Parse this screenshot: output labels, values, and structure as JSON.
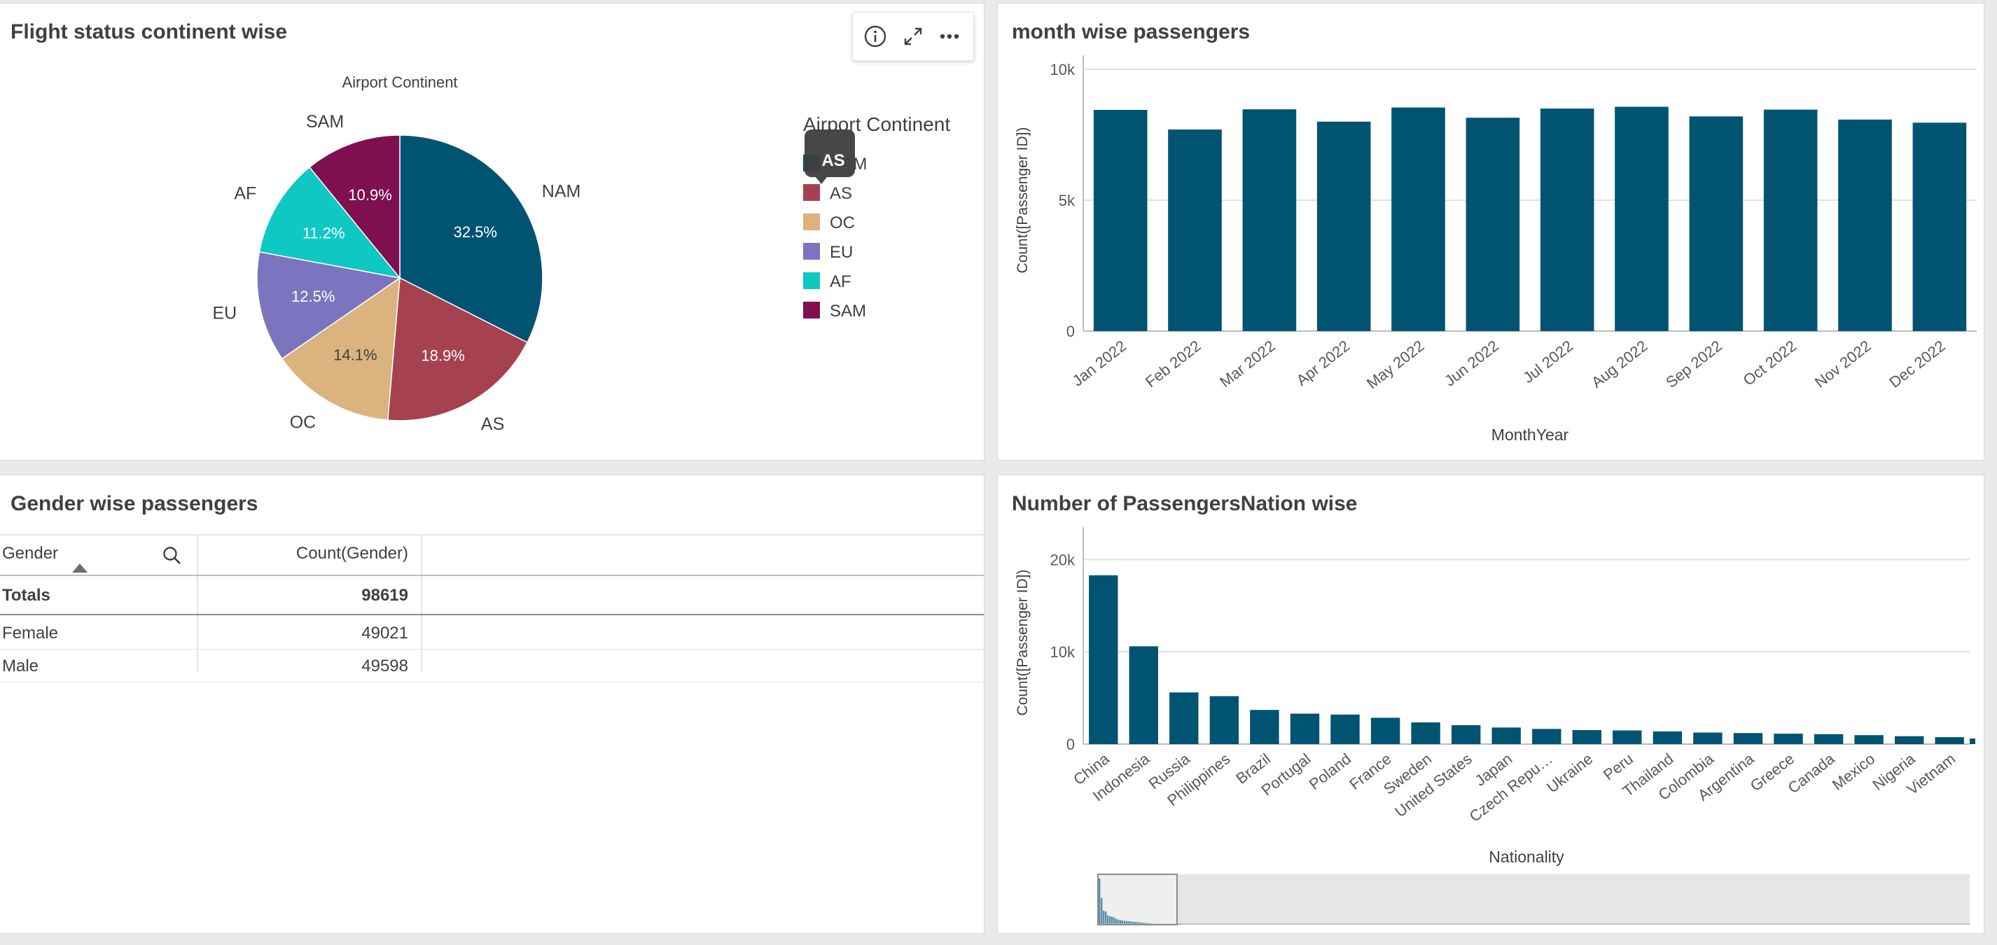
{
  "panels": {
    "pie": {
      "title": "Flight status continent wise"
    },
    "month": {
      "title": "month wise passengers"
    },
    "gender": {
      "title": "Gender wise passengers"
    },
    "nation": {
      "title": "Number of PassengersNation wise"
    }
  },
  "tooltip": {
    "text": "AS"
  },
  "table": {
    "headers": [
      "Gender",
      "Count(Gender)"
    ],
    "totals": {
      "label": "Totals",
      "value": "98619"
    },
    "rows": [
      {
        "gender": "Female",
        "count": "49021"
      },
      {
        "gender": "Male",
        "count": "49598"
      }
    ]
  },
  "colors": {
    "bar": "#005472",
    "NAM": "#005472",
    "AS": "#a6424f",
    "OC": "#dbb37e",
    "EU": "#7d74c0",
    "AF": "#0fc8c4",
    "SAM": "#7f0f4f"
  },
  "chart_data": [
    {
      "type": "pie",
      "title": "Airport Continent",
      "legend_title": "Airport Continent",
      "legend_position": "right",
      "slices": [
        {
          "label": "NAM",
          "value": 32.5,
          "text": "32.5%"
        },
        {
          "label": "AS",
          "value": 18.9,
          "text": "18.9%"
        },
        {
          "label": "OC",
          "value": 14.1,
          "text": "14.1%"
        },
        {
          "label": "EU",
          "value": 12.5,
          "text": "12.5%"
        },
        {
          "label": "AF",
          "value": 11.2,
          "text": "11.2%"
        },
        {
          "label": "SAM",
          "value": 10.9,
          "text": "10.9%"
        }
      ]
    },
    {
      "type": "bar",
      "categories": [
        "Jan 2022",
        "Feb 2022",
        "Mar 2022",
        "Apr 2022",
        "May 2022",
        "Jun 2022",
        "Jul 2022",
        "Aug 2022",
        "Sep 2022",
        "Oct 2022",
        "Nov 2022",
        "Dec 2022"
      ],
      "values": [
        8450,
        7700,
        8470,
        8000,
        8540,
        8150,
        8500,
        8570,
        8200,
        8460,
        8080,
        7960
      ],
      "xlabel": "MonthYear",
      "ylabel": "Count([Passenger ID])",
      "ylim": [
        0,
        10000
      ],
      "yticks": [
        "0",
        "5k",
        "10k"
      ],
      "grid": true
    },
    {
      "type": "bar",
      "categories": [
        "China",
        "Indonesia",
        "Russia",
        "Philippines",
        "Brazil",
        "Portugal",
        "Poland",
        "France",
        "Sweden",
        "United States",
        "Japan",
        "Czech Repu…",
        "Ukraine",
        "Peru",
        "Thailand",
        "Colombia",
        "Argentina",
        "Greece",
        "Canada",
        "Mexico",
        "Nigeria",
        "Vietnam"
      ],
      "values": [
        18300,
        10600,
        5600,
        5200,
        3700,
        3300,
        3200,
        2850,
        2350,
        2050,
        1800,
        1650,
        1520,
        1480,
        1370,
        1250,
        1200,
        1130,
        1080,
        970,
        860,
        750
      ],
      "xlabel": "Nationality",
      "ylabel": "Count([Passenger ID])",
      "ylim": [
        0,
        22000
      ],
      "yticks": [
        "0",
        "10k",
        "20k"
      ],
      "grid": true
    }
  ]
}
